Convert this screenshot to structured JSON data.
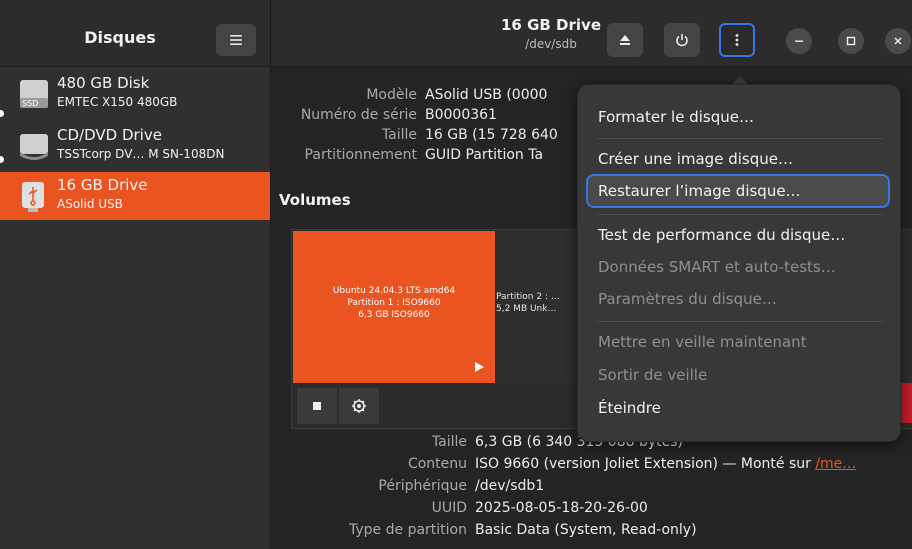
{
  "sidebar": {
    "title": "Disques",
    "drives": [
      {
        "name": "480 GB Disk",
        "sub": "EMTEC X150 480GB",
        "icon_label": "SSD",
        "icon": "ssd-icon"
      },
      {
        "name": "CD/DVD Drive",
        "sub": "TSSTcorp DV…   M SN-108DN",
        "icon": "optical-drive-icon"
      },
      {
        "name": "16 GB Drive",
        "sub": "ASolid USB",
        "icon": "usb-drive-icon",
        "selected": true
      }
    ]
  },
  "header": {
    "title": "16 GB Drive",
    "subtitle": "/dev/sdb"
  },
  "drive_info": [
    {
      "key": "Modèle",
      "value": "ASolid USB (0000"
    },
    {
      "key": "Numéro de série",
      "value": "B0000361"
    },
    {
      "key": "Taille",
      "value": "16 GB (15 728 640"
    },
    {
      "key": "Partitionnement",
      "value": "GUID Partition Ta"
    }
  ],
  "volumes": {
    "title": "Volumes",
    "partitions": [
      {
        "lines": [
          "Ubuntu 24.04.3 LTS amd64",
          "Partition 1 : ISO9660",
          "6,3 GB ISO9660"
        ]
      },
      {
        "lines": [
          "Partition 2 : …",
          "5,2 MB Unk…"
        ]
      }
    ]
  },
  "details": [
    {
      "key": "Taille",
      "value": "6,3 GB (6 340 313 088 bytes)"
    },
    {
      "key": "Contenu",
      "value": "ISO 9660 (version Joliet Extension) — Monté sur ",
      "link": "/me…"
    },
    {
      "key": "Périphérique",
      "value": "/dev/sdb1"
    },
    {
      "key": "UUID",
      "value": "2025-08-05-18-20-26-00"
    },
    {
      "key": "Type de partition",
      "value": "Basic Data (System, Read-only)"
    }
  ],
  "menu": {
    "items": [
      {
        "label": "Formater le disque…",
        "enabled": true
      },
      {
        "label": "Créer une image disque…",
        "enabled": true
      },
      {
        "label": "Restaurer l’image disque…",
        "enabled": true,
        "hovered": true
      },
      {
        "label": "Test de performance du disque…",
        "enabled": true
      },
      {
        "label": "Données SMART et auto-tests…",
        "enabled": false
      },
      {
        "label": "Paramètres du disque…",
        "enabled": false
      },
      {
        "label": "Mettre en veille maintenant",
        "enabled": false
      },
      {
        "label": "Sortir de veille",
        "enabled": false
      },
      {
        "label": "Éteindre",
        "enabled": true
      }
    ]
  },
  "colors": {
    "accent": "#e95420",
    "focus": "#3578e5",
    "destructive": "#c01c28"
  }
}
